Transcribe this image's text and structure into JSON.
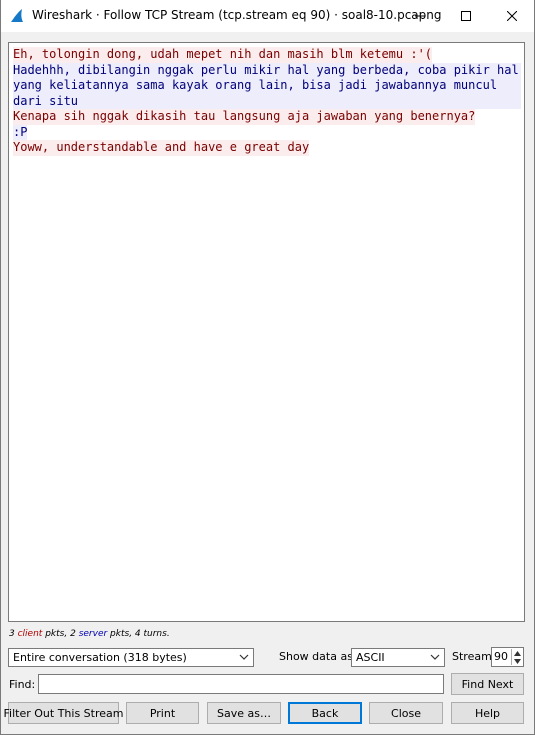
{
  "window": {
    "title": "Wireshark · Follow TCP Stream (tcp.stream eq 90) · soal8-10.pcapng",
    "icon": "wireshark-fin-icon",
    "controls": [
      "minimize-icon",
      "maximize-icon",
      "close-icon"
    ]
  },
  "stream": {
    "lines": [
      {
        "text": "Eh, tolongin dong, udah mepet nih dan masih blm ketemu :'(",
        "side": "client"
      },
      {
        "text": "Hadehhh, dibilangin nggak perlu mikir hal yang berbeda, coba pikir hal yang keliatannya sama kayak orang lain, bisa jadi jawabannya muncul dari situ",
        "side": "server"
      },
      {
        "text": "Kenapa sih nggak dikasih tau langsung aja jawaban yang benernya?",
        "side": "client"
      },
      {
        "text": ":P",
        "side": "server"
      },
      {
        "text": "Yoww, understandable and have e great day",
        "side": "client"
      }
    ],
    "colors": {
      "client_text": "#7a0000",
      "client_bg": "#fbeded",
      "server_text": "#00007a",
      "server_bg": "#ededfb"
    }
  },
  "summary": {
    "client_count": "3",
    "client_word": "client",
    "pkts_sep": " pkts, ",
    "server_count": "2",
    "server_word": "server",
    "tail": " pkts, 4 turns."
  },
  "controls": {
    "conversation": "Entire conversation (318 bytes)",
    "show_label": "Show data as",
    "format": "ASCII",
    "stream_label": "Stream",
    "stream_number": "90",
    "find_label": "Find:",
    "find_value": ""
  },
  "buttons": {
    "find_next": "Find Next",
    "filter_out": "Filter Out This Stream",
    "print": "Print",
    "save_as": "Save as…",
    "back": "Back",
    "close": "Close",
    "help": "Help"
  }
}
